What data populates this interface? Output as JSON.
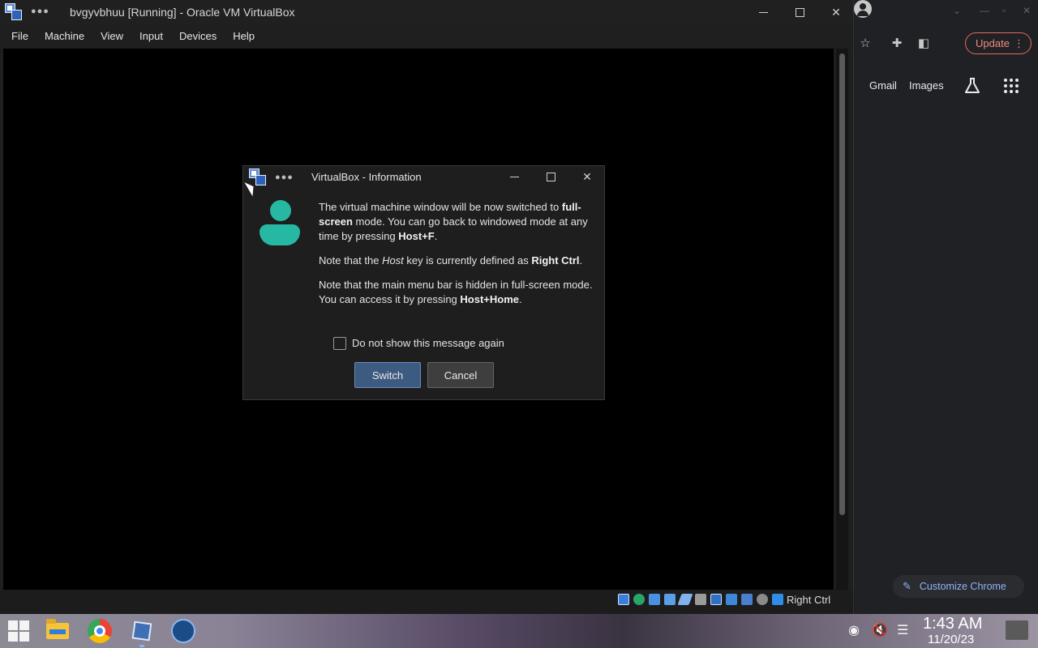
{
  "vbox_window": {
    "title": "bvgyvbhuu [Running] - Oracle VM VirtualBox",
    "dots": "●●●",
    "menu": [
      "File",
      "Machine",
      "View",
      "Input",
      "Devices",
      "Help"
    ],
    "window_controls": {
      "minimize": "—",
      "maximize": "☐",
      "close": "✕"
    },
    "status_host_key": "Right Ctrl"
  },
  "dialog": {
    "title": "VirtualBox - Information",
    "dots": "●●●",
    "paragraph1": {
      "pre": "The virtual machine window will be now switched to ",
      "bold1": "full-screen",
      "mid": " mode. You can go back to windowed mode at any time by pressing ",
      "bold2": "Host+F",
      "post": "."
    },
    "paragraph2": {
      "pre": "Note that the ",
      "italic": "Host",
      "mid": " key is currently defined as ",
      "bold": "Right Ctrl",
      "post": "."
    },
    "paragraph3": {
      "pre": "Note that the main menu bar is hidden in full-screen mode. You can access it by pressing ",
      "bold": "Host+Home",
      "post": "."
    },
    "checkbox_label": "Do not show this message again",
    "checkbox_checked": false,
    "switch_label": "Switch",
    "cancel_label": "Cancel"
  },
  "chrome_panel": {
    "update_label": "Update",
    "gmail_label": "Gmail",
    "images_label": "Images",
    "customize_label": "Customize Chrome"
  },
  "taskbar": {
    "apps": [
      "start-icon",
      "file-explorer-icon",
      "chrome-icon",
      "virtualbox-icon",
      "steam-icon"
    ],
    "time": "1:43 AM",
    "date": "11/20/23"
  },
  "colors": {
    "switch_button": "#3d5a80",
    "accent_teal": "#26b8a2",
    "update_red": "#f28b82",
    "chrome_link": "#8ab4f8"
  }
}
